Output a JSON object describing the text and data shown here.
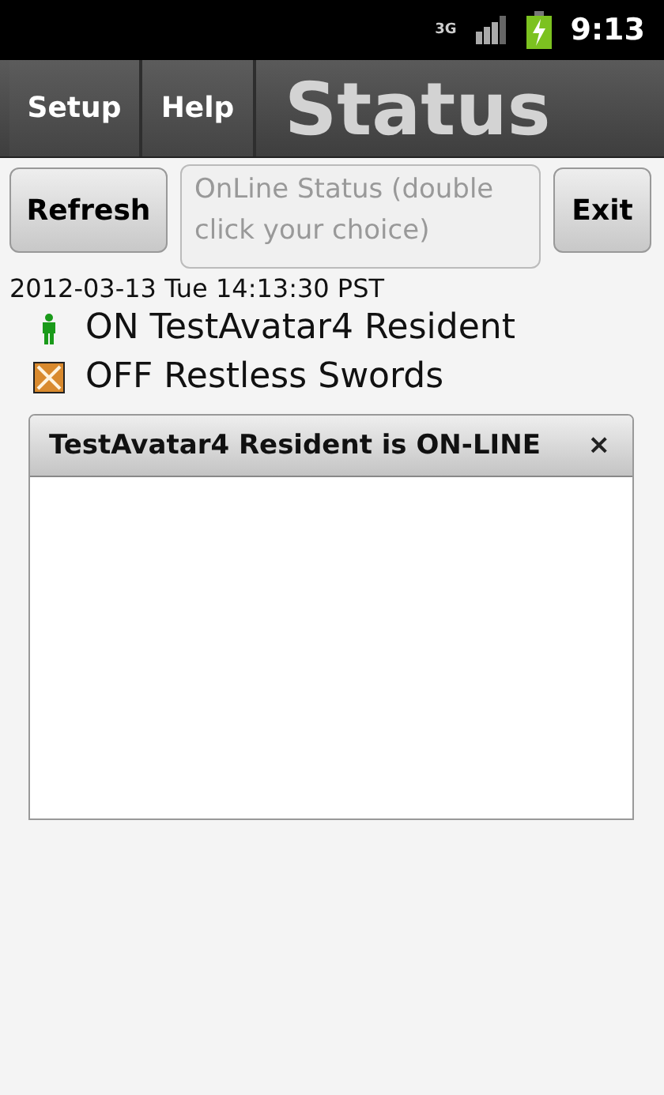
{
  "status_bar": {
    "network": "3G",
    "time": "9:13"
  },
  "menu": {
    "items": [
      "Setup",
      "Help"
    ],
    "title": "Status"
  },
  "toolbar": {
    "refresh": "Refresh",
    "status_field": {
      "placeholder": "OnLine Status (double click your choice)"
    },
    "exit": "Exit"
  },
  "timestamp": "2012-03-13 Tue 14:13:30 PST",
  "contacts": [
    {
      "label": "ON TestAvatar4 Resident",
      "online": true
    },
    {
      "label": "OFF Restless Swords",
      "online": false
    }
  ],
  "dialog": {
    "title": "TestAvatar4 Resident is ON-LINE",
    "close": "×"
  }
}
